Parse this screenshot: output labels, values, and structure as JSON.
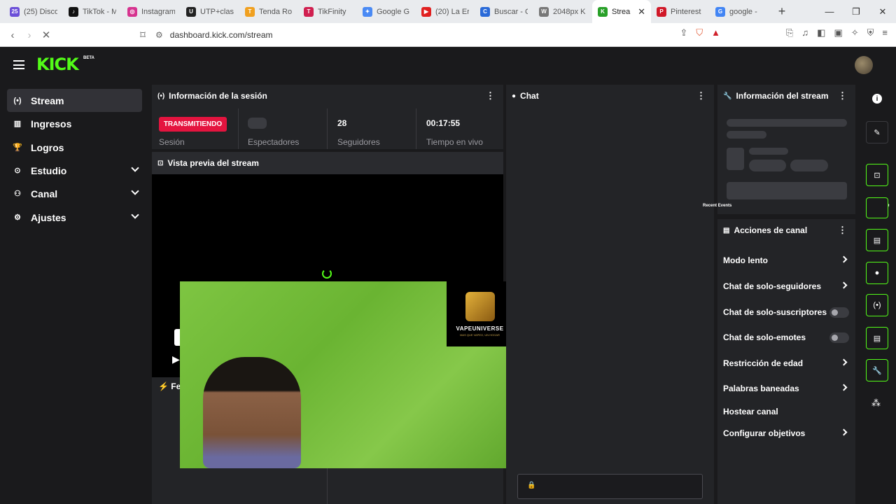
{
  "browser": {
    "tabs": [
      {
        "label": "(25) Disco",
        "fav": "25",
        "color": "#6b4fd8"
      },
      {
        "label": "TikTok - M",
        "fav": "♪",
        "color": "#111"
      },
      {
        "label": "Instagram",
        "fav": "◎",
        "color": "#d6338f"
      },
      {
        "label": "UTP+clas",
        "fav": "U",
        "color": "#222"
      },
      {
        "label": "Tenda Ro",
        "fav": "T",
        "color": "#f0a020"
      },
      {
        "label": "TikFinity",
        "fav": "T",
        "color": "#d02050"
      },
      {
        "label": "Google G",
        "fav": "✦",
        "color": "#4a8af4"
      },
      {
        "label": "(20) La Er",
        "fav": "▶",
        "color": "#e02020"
      },
      {
        "label": "Buscar - C",
        "fav": "C",
        "color": "#2a6ad8"
      },
      {
        "label": "2048px K",
        "fav": "W",
        "color": "#777"
      },
      {
        "label": "Strea",
        "fav": "K",
        "color": "#28a028"
      },
      {
        "label": "Pinterest",
        "fav": "P",
        "color": "#d01828"
      },
      {
        "label": "google -",
        "fav": "G",
        "color": "#4285f4"
      }
    ],
    "url": "dashboard.kick.com/stream"
  },
  "kick": {
    "logo": "KICK",
    "beta": "BETA"
  },
  "sidebar": {
    "items": [
      {
        "label": "Stream",
        "icon": "broadcast-icon",
        "glyph": "(•)"
      },
      {
        "label": "Ingresos",
        "icon": "chart-icon",
        "glyph": "▥"
      },
      {
        "label": "Logros",
        "icon": "trophy-icon",
        "glyph": "🏆"
      },
      {
        "label": "Estudio",
        "icon": "studio-icon",
        "glyph": "⊙"
      },
      {
        "label": "Canal",
        "icon": "users-icon",
        "glyph": "⚇"
      },
      {
        "label": "Ajustes",
        "icon": "gear-icon",
        "glyph": "⚙"
      }
    ]
  },
  "session": {
    "title": "Información de la sesión",
    "status": "TRANSMITIENDO",
    "session_label": "Sesión",
    "viewers_label": "Espectadores",
    "followers_value": "28",
    "followers_label": "Seguidores",
    "live_time_value": "00:17:55",
    "live_time_label": "Tiempo en vivo"
  },
  "preview": {
    "title": "Vista previa del stream",
    "partial_feed": "Fe",
    "overlay_title": "VAPEUNIVERSE",
    "overlay_sub": "MAS QUE VAPEO, UN HOGAR"
  },
  "chat": {
    "title": "Chat"
  },
  "stream_info": {
    "title": "Información del stream",
    "recent_events": "Recent Events"
  },
  "channel_actions": {
    "title": "Acciones de canal",
    "items": [
      {
        "label": "Modo lento",
        "kind": "chevron"
      },
      {
        "label": "Chat de solo-seguidores",
        "kind": "chevron"
      },
      {
        "label": "Chat de solo-suscriptores",
        "kind": "toggle"
      },
      {
        "label": "Chat de solo-emotes",
        "kind": "toggle"
      },
      {
        "label": "Restricción de edad",
        "kind": "chevron"
      },
      {
        "label": "Palabras baneadas",
        "kind": "chevron"
      },
      {
        "label": "Hostear canal",
        "kind": "none"
      },
      {
        "label": "Configurar objetivos",
        "kind": "chevron"
      }
    ]
  },
  "colors": {
    "accent": "#53fc18",
    "live": "#e4143f"
  }
}
